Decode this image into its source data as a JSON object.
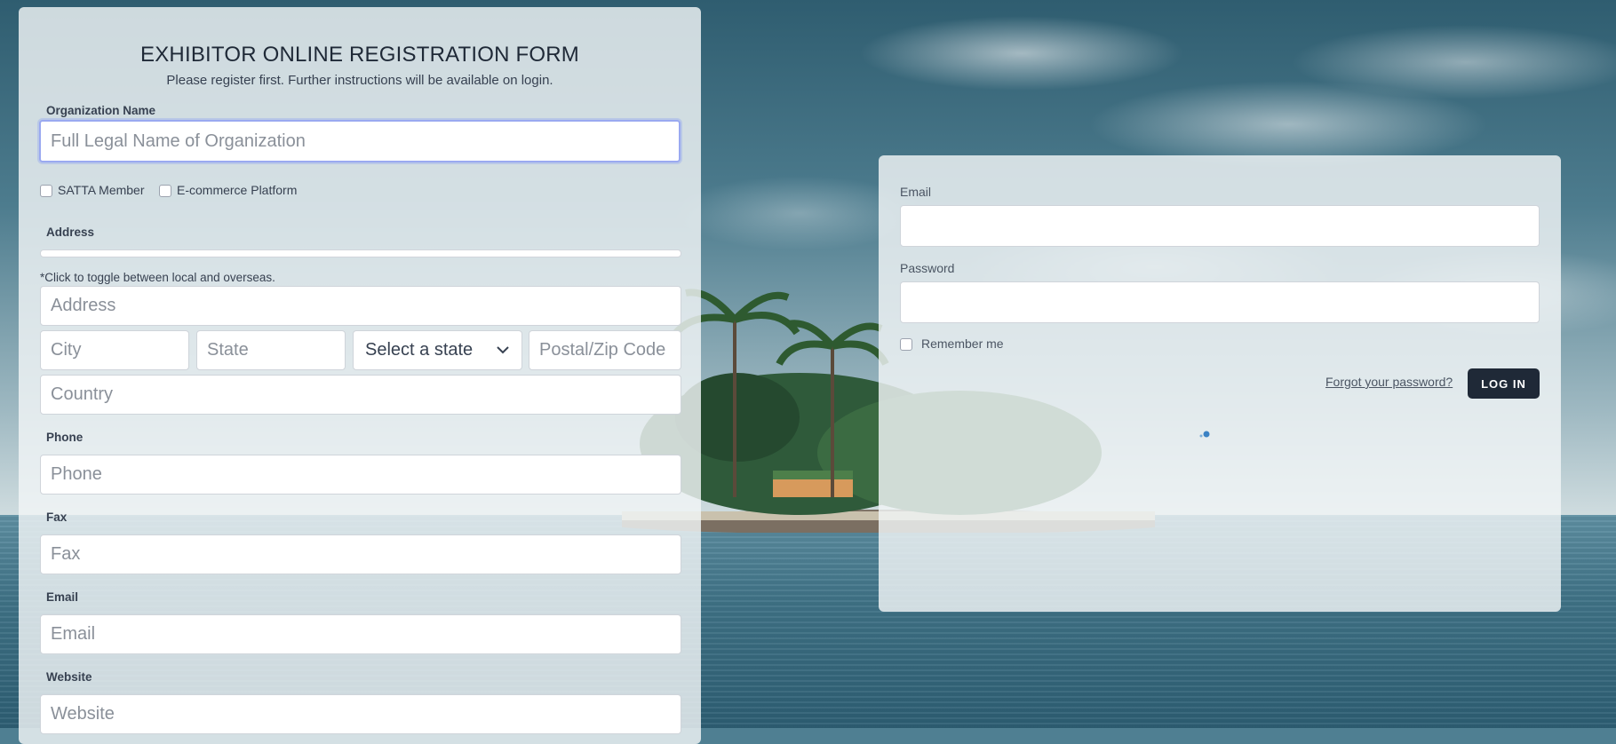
{
  "colors": {
    "card_bg": "#f1f5f6",
    "button_bg": "#1f2937",
    "focus_ring": "#9aa9f0",
    "spinner_accent": "#3b82c4"
  },
  "registration": {
    "title": "EXHIBITOR ONLINE REGISTRATION FORM",
    "subtitle": "Please register first. Further instructions will be available on login.",
    "org_label": "Organization Name",
    "org_placeholder": "Full Legal Name of Organization",
    "org_value": "",
    "checkbox_satta": "SATTA Member",
    "checkbox_ecommerce": "E-commerce Platform",
    "address_label": "Address",
    "toggle_hint": "*Click to toggle between local and overseas.",
    "address_placeholder": "Address",
    "city_placeholder": "City",
    "state_placeholder": "State",
    "state_select_value": "Select a state",
    "zip_placeholder": "Postal/Zip Code",
    "country_placeholder": "Country",
    "phone_label": "Phone",
    "phone_placeholder": "Phone",
    "fax_label": "Fax",
    "fax_placeholder": "Fax",
    "email_label": "Email",
    "email_placeholder": "Email",
    "website_label": "Website",
    "website_placeholder": "Website"
  },
  "login": {
    "email_label": "Email",
    "password_label": "Password",
    "remember_label": "Remember me",
    "forgot_link": "Forgot your password?",
    "login_button": "LOG IN"
  },
  "icons": {
    "select_chevron": "chevron-down-icon",
    "loading": "loading-spinner-icon"
  }
}
